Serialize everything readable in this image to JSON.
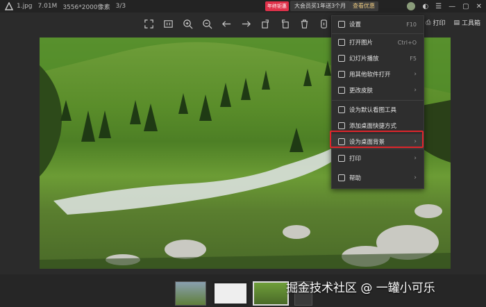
{
  "titlebar": {
    "filename": "1.jpg",
    "filesize": "7.01M",
    "resolution": "3556*2000像素",
    "page": "3/3",
    "promo_badge": "年终钜惠",
    "promo_text": "大会员买1年送3个月",
    "promo_button": "查看优惠"
  },
  "right_tools": {
    "print": "打印",
    "toolbox": "工具箱"
  },
  "menu": {
    "items": [
      {
        "label": "设置",
        "shortcut": "F10"
      },
      {
        "label": "打开图片",
        "shortcut": "Ctrl+O"
      },
      {
        "label": "幻灯片播放",
        "shortcut": "F5"
      },
      {
        "label": "用其他软件打开",
        "arrow": "›"
      },
      {
        "label": "更改皮肤",
        "arrow": "›"
      },
      {
        "label": "设为默认看图工具"
      },
      {
        "label": "添加桌面快捷方式"
      },
      {
        "label": "设为桌面背景",
        "arrow": "›"
      },
      {
        "label": "打印",
        "arrow": "›"
      },
      {
        "label": "帮助",
        "arrow": "›"
      }
    ]
  },
  "watermark": "掘金技术社区 @ 一罐小可乐",
  "colors": {
    "highlight": "#e0252b",
    "promo": "#e0314a",
    "promo_btn_text": "#e9c77f"
  }
}
